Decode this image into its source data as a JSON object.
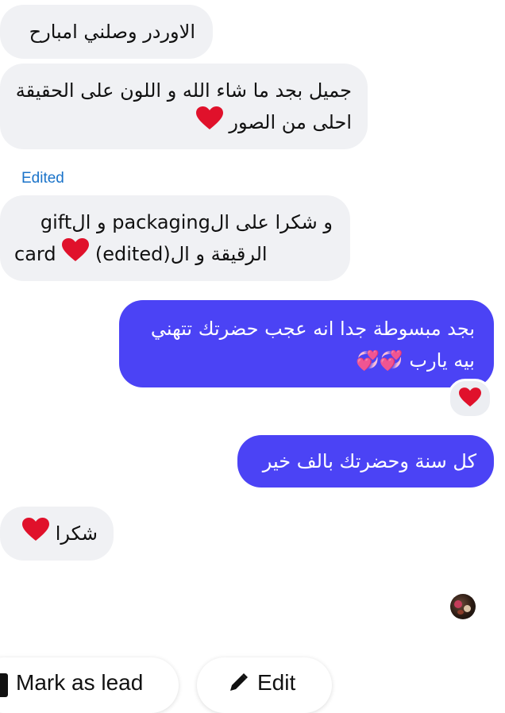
{
  "messages": [
    {
      "direction": "incoming",
      "lines": [
        "الاوردر وصلني امبارح"
      ]
    },
    {
      "direction": "incoming",
      "lines": [
        "جميل بجد ما شاء الله و اللون على الحقيقة",
        "احلى من الصور"
      ],
      "emoji": "red-heart"
    },
    {
      "direction": "incoming",
      "edited_label": "Edited",
      "lines": [
        "و شكرا على الpackaging و الgift",
        "card ❤️ (edited)الرقيقة و ال"
      ]
    },
    {
      "direction": "outgoing",
      "lines": [
        "بجد مبسوطة جدا انه عجب حضرتك تتهني",
        "بيه يارب 💞💞"
      ],
      "reaction": "red-heart"
    },
    {
      "direction": "outgoing",
      "lines": [
        "كل سنة وحضرتك بالف خير"
      ]
    },
    {
      "direction": "incoming",
      "lines": [
        "شكرا"
      ],
      "emoji": "red-heart"
    }
  ],
  "msg3_parts": {
    "line1": "و شكرا على الpackaging و الgift",
    "line2_card": "card",
    "line2_edited": "(edited)",
    "line2_arabic": "الرقيقة و ال"
  },
  "seen_avatar": "profile-avatar",
  "actions": {
    "mark_as_lead": "Mark as lead",
    "edit": "Edit"
  },
  "colors": {
    "incoming_bubble": "#f0f1f4",
    "outgoing_bubble": "#4b43f5",
    "edited_label": "#1a73c9",
    "heart": "#e0112b"
  }
}
